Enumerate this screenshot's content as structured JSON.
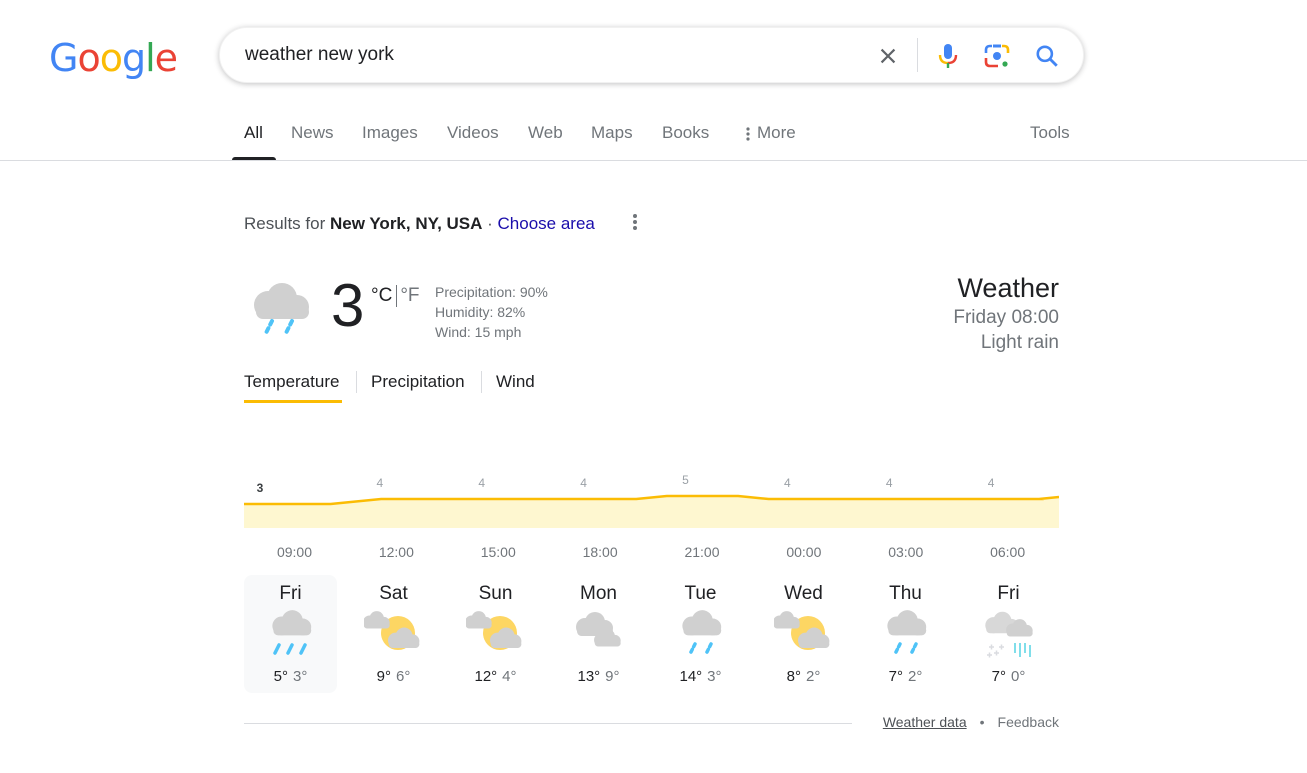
{
  "logo": {
    "letters": [
      "G",
      "o",
      "o",
      "g",
      "l",
      "e"
    ],
    "colors": [
      "#4285f4",
      "#ea4335",
      "#fbbc05",
      "#4285f4",
      "#34a853",
      "#ea4335"
    ]
  },
  "search": {
    "query": "weather new york",
    "icons": [
      "close-icon",
      "microphone-icon",
      "google-lens-icon",
      "search-icon"
    ]
  },
  "tabs": [
    {
      "label": "All",
      "active": true
    },
    {
      "label": "News"
    },
    {
      "label": "Images"
    },
    {
      "label": "Videos"
    },
    {
      "label": "Web"
    },
    {
      "label": "Maps"
    },
    {
      "label": "Books"
    },
    {
      "label": "More"
    }
  ],
  "tools_label": "Tools",
  "results_for": {
    "prefix": "Results for ",
    "location": "New York, NY, USA",
    "sep": " · ",
    "choose_area": "Choose area"
  },
  "current": {
    "icon": "rain-icon",
    "temp": "3",
    "unit_c": "°C",
    "unit_f": "°F",
    "precipitation": "Precipitation: 90%",
    "humidity": "Humidity: 82%",
    "wind": "Wind: 15 mph"
  },
  "header": {
    "title": "Weather",
    "time": "Friday 08:00",
    "condition": "Light rain"
  },
  "chart_tabs": [
    {
      "label": "Temperature",
      "active": true
    },
    {
      "label": "Precipitation"
    },
    {
      "label": "Wind"
    }
  ],
  "chart_data": {
    "type": "area",
    "title": "Temperature",
    "x": [
      "09:00",
      "12:00",
      "15:00",
      "18:00",
      "21:00",
      "00:00",
      "03:00",
      "06:00"
    ],
    "values": [
      3,
      4,
      4,
      4,
      5,
      4,
      4,
      4
    ],
    "labels": [
      "3",
      "4",
      "4",
      "4",
      "5",
      "4",
      "4",
      "4"
    ],
    "line_color": "#fbbc04",
    "fill_color": "#fef7d0",
    "ylim": [
      0,
      5.5
    ]
  },
  "forecast": [
    {
      "day": "Fri",
      "icon": "rain",
      "hi": "5°",
      "lo": "3°",
      "selected": true
    },
    {
      "day": "Sat",
      "icon": "partly-cloudy",
      "hi": "9°",
      "lo": "6°"
    },
    {
      "day": "Sun",
      "icon": "partly-cloudy",
      "hi": "12°",
      "lo": "4°"
    },
    {
      "day": "Mon",
      "icon": "cloudy",
      "hi": "13°",
      "lo": "9°"
    },
    {
      "day": "Tue",
      "icon": "light-rain",
      "hi": "14°",
      "lo": "3°"
    },
    {
      "day": "Wed",
      "icon": "partly-cloudy",
      "hi": "8°",
      "lo": "2°"
    },
    {
      "day": "Thu",
      "icon": "light-rain",
      "hi": "7°",
      "lo": "2°"
    },
    {
      "day": "Fri",
      "icon": "rain-and-snow",
      "hi": "7°",
      "lo": "0°"
    }
  ],
  "footer": {
    "weather_data": "Weather data",
    "dot": "•",
    "feedback": "Feedback"
  }
}
